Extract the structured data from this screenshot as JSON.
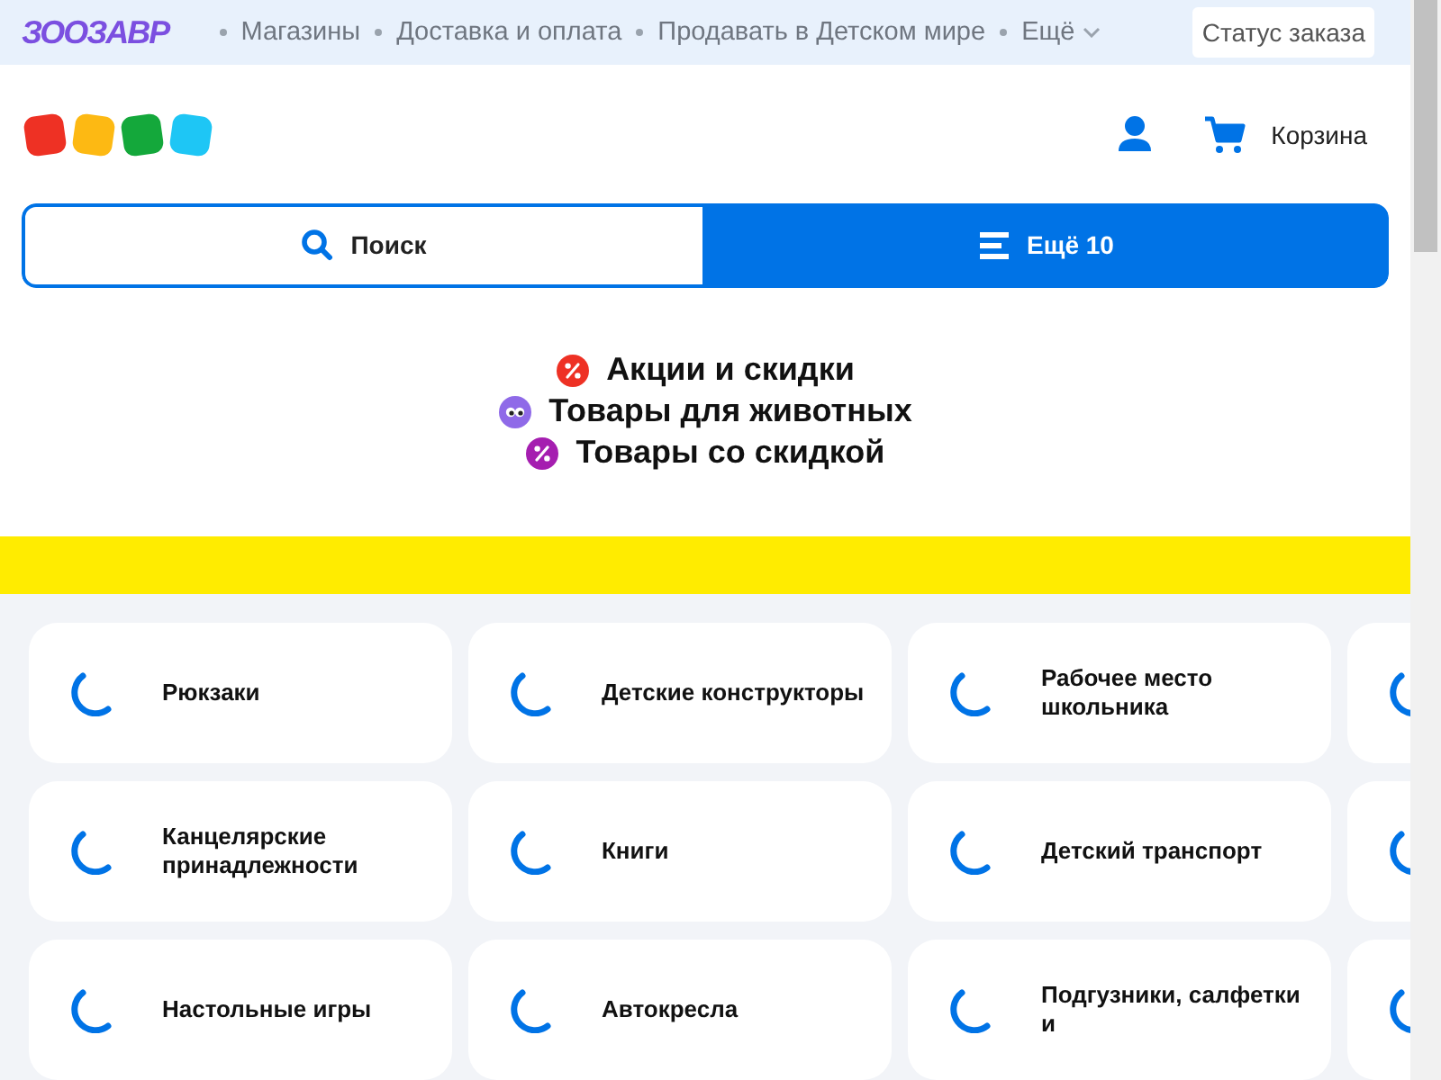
{
  "top_bar": {
    "logo": "ЗООЗАВР",
    "links": [
      "Магазины",
      "Доставка и оплата",
      "Продавать в Детском мире",
      "Ещё"
    ],
    "status_button": "Статус заказа"
  },
  "header": {
    "cart_label": "Корзина"
  },
  "actions": [
    {
      "kind": "search",
      "label": "Поиск"
    },
    {
      "kind": "menu",
      "label": "Ещё 10"
    }
  ],
  "promos": [
    {
      "label": "Акции и скидки",
      "color": "#ee3124",
      "kind": "percent"
    },
    {
      "label": "Товары для животных",
      "color": "#8f6ae8",
      "kind": "eyes"
    },
    {
      "label": "Товары со скидкой",
      "color": "#a51eb0",
      "kind": "percent"
    }
  ],
  "categories": [
    [
      "Рюкзаки",
      "Детские конструкторы",
      "Рабочее место школьника"
    ],
    [
      "Канцелярские принадлежности",
      "Книги",
      "Детский транспорт"
    ],
    [
      "Настольные игры",
      "Автокресла",
      "Подгузники, салфетки и"
    ]
  ]
}
